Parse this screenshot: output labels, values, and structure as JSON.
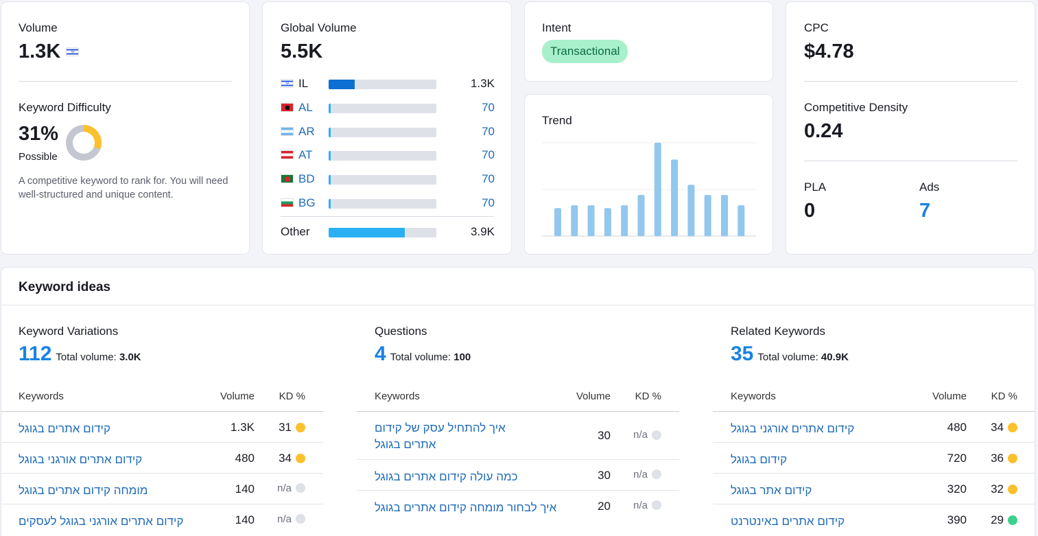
{
  "volume": {
    "label": "Volume",
    "value": "1.3K",
    "flag_icon": "israel-flag-icon"
  },
  "kd": {
    "label": "Keyword Difficulty",
    "value": "31%",
    "rating": "Possible",
    "percent": 31,
    "description": "A competitive keyword to rank for. You will need well-structured and unique content."
  },
  "global": {
    "label": "Global Volume",
    "value": "5.5K",
    "countries": [
      {
        "code": "IL",
        "value": "1.3K",
        "fill": 0.24,
        "flag": "flag-il"
      },
      {
        "code": "AL",
        "value": "70",
        "fill": 0.02,
        "flag": "flag-al"
      },
      {
        "code": "AR",
        "value": "70",
        "fill": 0.02,
        "flag": "flag-ar"
      },
      {
        "code": "AT",
        "value": "70",
        "fill": 0.02,
        "flag": "flag-at"
      },
      {
        "code": "BD",
        "value": "70",
        "fill": 0.02,
        "flag": "flag-bd"
      },
      {
        "code": "BG",
        "value": "70",
        "fill": 0.02,
        "flag": "flag-bg"
      }
    ],
    "other": {
      "label": "Other",
      "value": "3.9K",
      "fill": 0.71
    }
  },
  "intent": {
    "label": "Intent",
    "badge": "Transactional"
  },
  "trend": {
    "label": "Trend",
    "values": [
      0.3,
      0.33,
      0.33,
      0.3,
      0.33,
      0.44,
      1.0,
      0.82,
      0.55,
      0.44,
      0.44,
      0.33
    ]
  },
  "cpc": {
    "label": "CPC",
    "value": "$4.78"
  },
  "density": {
    "label": "Competitive Density",
    "value": "0.24"
  },
  "pla": {
    "label": "PLA",
    "value": "0"
  },
  "ads": {
    "label": "Ads",
    "value": "7"
  },
  "ideas": {
    "title": "Keyword ideas",
    "total_label": "Total volume:",
    "headers": {
      "keywords": "Keywords",
      "volume": "Volume",
      "kd": "KD %"
    },
    "variations": {
      "title": "Keyword Variations",
      "count": "112",
      "total": "3.0K",
      "rows": [
        {
          "kw": "קידום אתרים בגוגל",
          "vol": "1.3K",
          "kd": "31",
          "color": "#fbc02d"
        },
        {
          "kw": "קידום אתרים אורגני בגוגל",
          "vol": "480",
          "kd": "34",
          "color": "#fbc02d"
        },
        {
          "kw": "מומחה קידום אתרים בגוגל",
          "vol": "140",
          "kd": "n/a",
          "color": "#dfe1e8"
        },
        {
          "kw": "קידום אתרים אורגני בגוגל לעסקים",
          "vol": "140",
          "kd": "n/a",
          "color": "#dfe1e8"
        }
      ]
    },
    "questions": {
      "title": "Questions",
      "count": "4",
      "total": "100",
      "rows": [
        {
          "kw": "איך להתחיל עסק של קידום אתרים בגוגל",
          "vol": "30",
          "kd": "n/a",
          "color": "#dfe1e8",
          "tall": true
        },
        {
          "kw": "כמה עולה קידום אתרים בגוגל",
          "vol": "30",
          "kd": "n/a",
          "color": "#dfe1e8"
        },
        {
          "kw": "איך לבחור מומחה קידום אתרים בגוגל",
          "vol": "20",
          "kd": "n/a",
          "color": "#dfe1e8"
        }
      ]
    },
    "related": {
      "title": "Related Keywords",
      "count": "35",
      "total": "40.9K",
      "rows": [
        {
          "kw": "קידום אתרים אורגני בגוגל",
          "vol": "480",
          "kd": "34",
          "color": "#fbc02d"
        },
        {
          "kw": "קידום בגוגל",
          "vol": "720",
          "kd": "36",
          "color": "#fbc02d"
        },
        {
          "kw": "קידום אתר בגוגל",
          "vol": "320",
          "kd": "32",
          "color": "#fbc02d"
        },
        {
          "kw": "קידום אתרים באינטרנט",
          "vol": "390",
          "kd": "29",
          "color": "#3ecf8e"
        }
      ]
    }
  }
}
